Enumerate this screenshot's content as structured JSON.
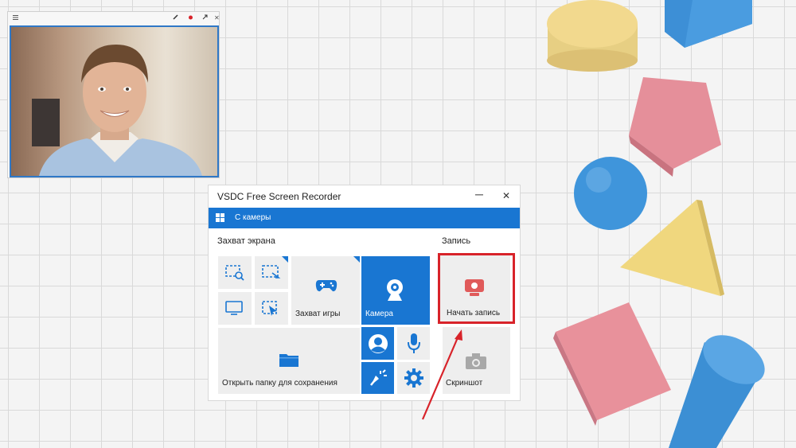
{
  "webcam_window": {
    "menu_icon": "hamburger-icon",
    "controls": [
      "pin-icon",
      "record-dot-icon",
      "expand-icon",
      "close-icon"
    ],
    "close_glyph": "✕"
  },
  "recorder": {
    "title": "VSDC Free Screen Recorder",
    "minimize_glyph": "─",
    "close_glyph": "✕",
    "source_bar": {
      "label": "С камеры"
    },
    "screen_capture_section": "Захват экрана",
    "record_section": "Запись",
    "tiles": {
      "game_capture": "Захват игры",
      "camera": "Камера",
      "start_recording": "Начать запись",
      "open_folder": "Открыть папку для сохранения",
      "screenshot": "Скриншот"
    }
  },
  "colors": {
    "accent_blue": "#1976d2",
    "highlight_red": "#d8232a",
    "tile_gray": "#eeeeee",
    "record_red": "#e05a5a"
  }
}
